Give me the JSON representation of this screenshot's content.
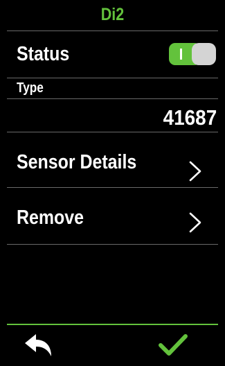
{
  "header": {
    "title": "Di2"
  },
  "status": {
    "label": "Status",
    "toggle": "on",
    "toggle_mark": "I"
  },
  "type": {
    "label": "Type",
    "value": "41687"
  },
  "menu": [
    {
      "label": "Sensor Details",
      "icon": "chevron-right-icon"
    },
    {
      "label": "Remove",
      "icon": "chevron-right-icon"
    }
  ],
  "footer": {
    "back_icon": "back-arrow-icon",
    "confirm_icon": "checkmark-icon"
  },
  "colors": {
    "accent": "#63c23c",
    "background": "#000000",
    "divider": "#6a6a6a",
    "toggle_knob": "#d4d4d4"
  }
}
